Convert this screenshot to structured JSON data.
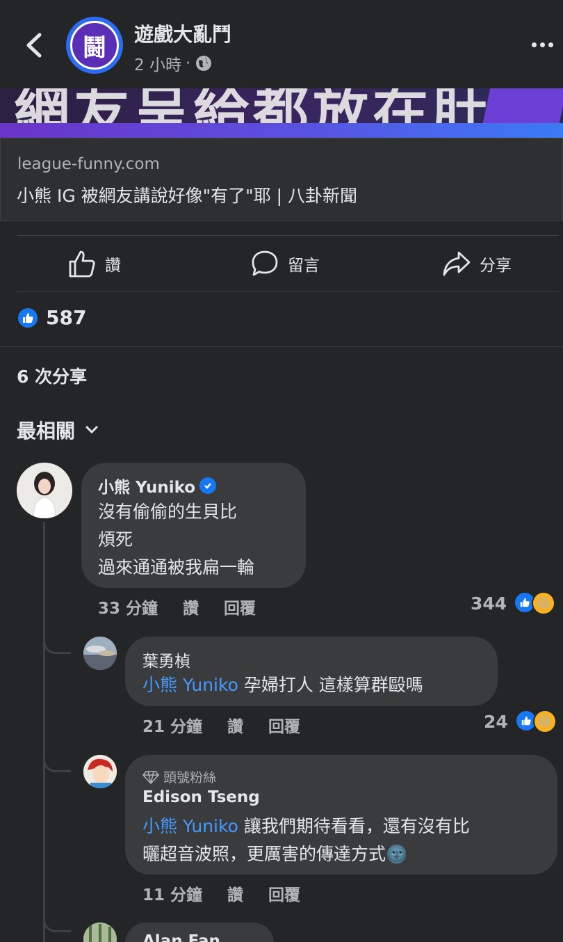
{
  "header": {
    "page_name": "遊戲大亂鬥",
    "time": "2 小時",
    "separator": "·",
    "avatar_glyph": "鬪"
  },
  "banner": {
    "glyphs": "網友呈給都放在肚子 鬪"
  },
  "link_preview": {
    "domain": "league-funny.com",
    "title": "小熊 IG 被網友講說好像\"有了\"耶 | 八卦新聞"
  },
  "actions": {
    "like": "讚",
    "comment": "留言",
    "share": "分享"
  },
  "stats": {
    "likes": "587",
    "shares": "6 次分享"
  },
  "sort": {
    "label": "最相關"
  },
  "comments": [
    {
      "author": "小熊 Yuniko",
      "verified": true,
      "lines": [
        "沒有偷偷的生貝比",
        "煩死",
        "過來通通被我扁一輪"
      ],
      "time": "33 分鐘",
      "like": "讚",
      "reply": "回覆",
      "reactions": "344"
    },
    {
      "author": "葉勇楨",
      "mention": "小熊 Yuniko",
      "text": " 孕婦打人 這樣算群毆嗎",
      "time": "21 分鐘",
      "like": "讚",
      "reply": "回覆",
      "reactions": "24"
    },
    {
      "badge": "頭號粉絲",
      "author": "Edison Tseng",
      "mention": "小熊 Yuniko",
      "text_line1": " 讓我們期待看看，還有沒有比",
      "text_line2": "曬超音波照，更厲害的傳達方式",
      "emoji": "🌚",
      "time": "11 分鐘",
      "like": "讚",
      "reply": "回覆"
    },
    {
      "author": "Alan Fan"
    }
  ],
  "colors": {
    "background": "#242526",
    "bubble": "#3a3b3c",
    "mention": "#4599ff",
    "like_blue": "#1877f2",
    "haha_yellow": "#f7b125"
  }
}
